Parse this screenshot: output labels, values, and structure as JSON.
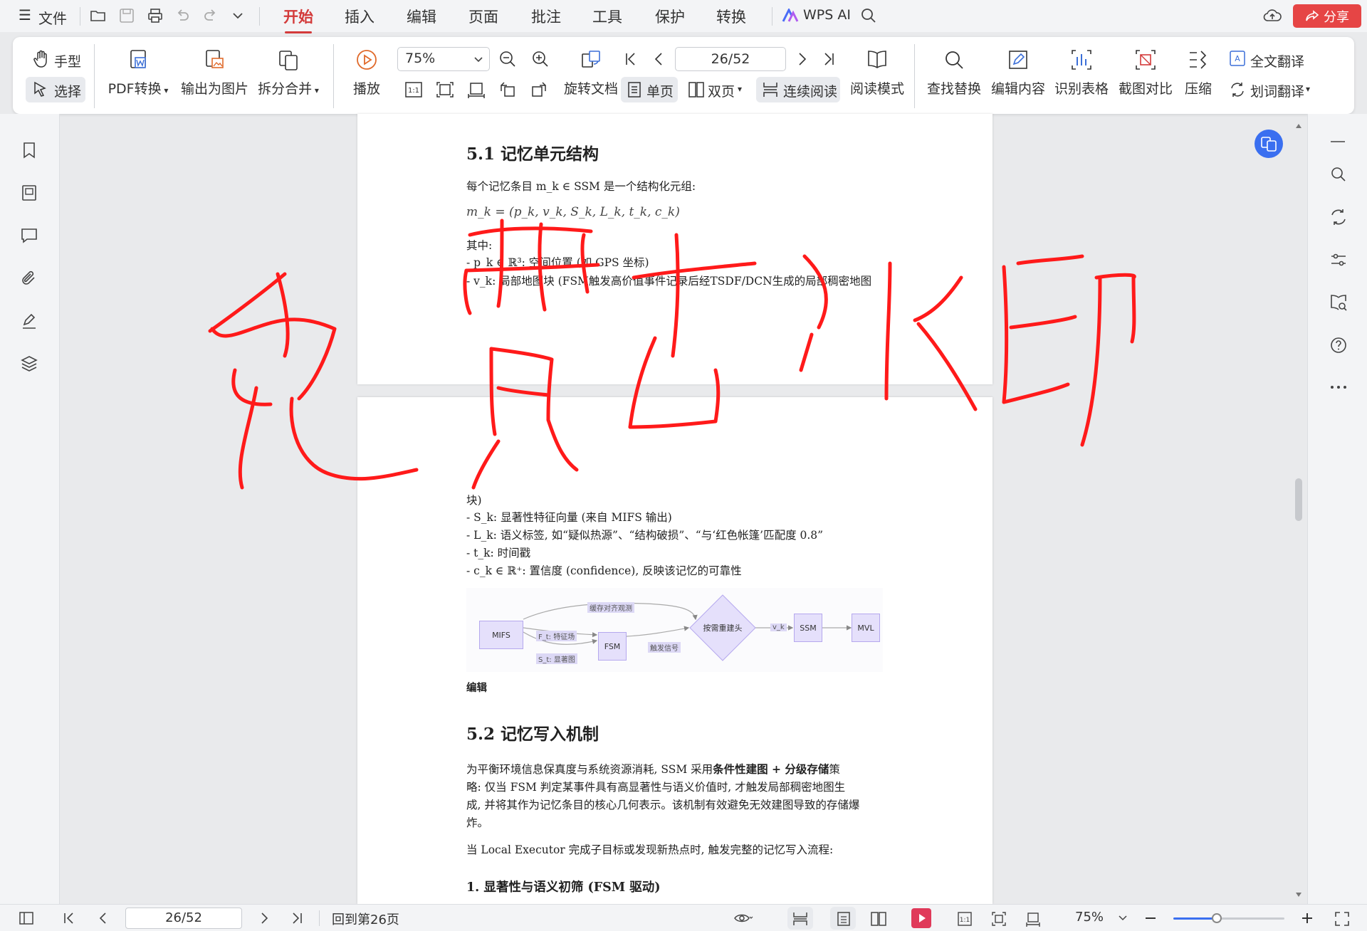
{
  "menubar": {
    "file_label": "文件",
    "tabs": [
      "开始",
      "插入",
      "编辑",
      "页面",
      "批注",
      "工具",
      "保护",
      "转换"
    ],
    "active_tab": "开始",
    "wps_ai": "WPS AI",
    "share": "分享",
    "accent_color": "#d33a3a"
  },
  "ribbon": {
    "hand": "手型",
    "select": "选择",
    "pdf_convert": "PDF转换",
    "export_image": "输出为图片",
    "split_merge": "拆分合并",
    "play": "播放",
    "zoom_value": "75%",
    "rotate": "旋转文档",
    "page_value": "26/52",
    "single": "单页",
    "double": "双页",
    "continuous": "连续阅读",
    "read_mode": "阅读模式",
    "find_replace": "查找替换",
    "edit_content": "编辑内容",
    "recognize_table": "识别表格",
    "screenshot_compare": "截图对比",
    "compress": "压缩",
    "full_translate": "全文翻译",
    "word_translate": "划词翻译"
  },
  "page1": {
    "heading": "5.1 记忆单元结构",
    "intro": "每个记忆条目 m_k ∈ SSM 是一个结构化元组:",
    "formula": "m_k = (p_k, v_k, S_k, L_k, t_k, c_k)",
    "where": "其中:",
    "item1": "- p_k ∈ ℝ³: 空间位置 (如 GPS 坐标)",
    "item2": "- v_k: 局部地图块 (FSM触发高价值事件记录后经TSDF/DCN生成的局部稠密地图"
  },
  "page2": {
    "cont": "块)",
    "item3": "- S_k: 显著性特征向量 (来自 MIFS 输出)",
    "item4": "- L_k: 语义标签, 如“疑似热源”、“结构破损”、“与‘红色帐篷’匹配度 0.8”",
    "item5": "- t_k: 时间戳",
    "item6": "- c_k ∈ ℝ⁺: 置信度 (confidence), 反映该记忆的可靠性",
    "edit_label": "编辑",
    "heading2": "5.2 记忆写入机制",
    "para1_a": "为平衡环境信息保真度与系统资源消耗, SSM 采用",
    "para1_bold": "条件性建图 + 分级存储",
    "para1_b": "策",
    "para1_line2": "略: 仅当 FSM 判定某事件具有高显著性与语义价值时, 才触发局部稠密地图生",
    "para1_line3": "成, 并将其作为记忆条目的核心几何表示。该机制有效避免无效建图导致的存储爆",
    "para1_line4": "炸。",
    "para2": "当 Local Executor 完成子目标或发现新热点时, 触发完整的记忆写入流程:",
    "heading3": "1. 显著性与语义初筛 (FSM 驱动)"
  },
  "diagram": {
    "nodes": [
      "MIFS",
      "FSM",
      "按需重建头",
      "SSM",
      "MVL"
    ],
    "edges": [
      "缓存对齐观测",
      "F_t: 特征场",
      "S_t: 显著图",
      "触发信号",
      "v_k"
    ]
  },
  "watermark_text": "免费去水印",
  "statusbar": {
    "page_value": "26/52",
    "back_to_page": "回到第26页",
    "zoom_value": "75%"
  }
}
